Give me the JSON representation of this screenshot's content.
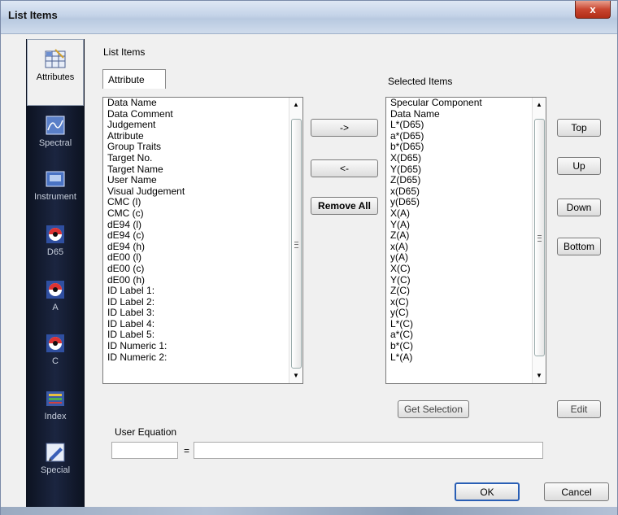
{
  "window": {
    "title": "List Items",
    "close_label": "x"
  },
  "nav": {
    "items": [
      {
        "label": "Attributes",
        "icon": "attributes-grid-icon",
        "active": true
      },
      {
        "label": "Spectral",
        "icon": "spectral-chart-icon"
      },
      {
        "label": "Instrument",
        "icon": "instrument-icon"
      },
      {
        "label": "D65",
        "icon": "illuminant-d65-icon"
      },
      {
        "label": "A",
        "icon": "illuminant-a-icon"
      },
      {
        "label": "C",
        "icon": "illuminant-c-icon"
      },
      {
        "label": "Index",
        "icon": "index-icon"
      },
      {
        "label": "Special",
        "icon": "special-pencil-icon"
      }
    ]
  },
  "main": {
    "section_title": "List Items",
    "tab_label": "Attribute",
    "selected_title": "Selected Items",
    "available_items": [
      "Data Name",
      "Data Comment",
      "Judgement",
      "Attribute",
      "Group Traits",
      "Target No.",
      "Target Name",
      "User Name",
      "Visual Judgement",
      "CMC (l)",
      "CMC (c)",
      "dE94 (l)",
      "dE94 (c)",
      "dE94 (h)",
      "dE00 (l)",
      "dE00 (c)",
      "dE00 (h)",
      "ID Label 1:",
      "ID Label 2:",
      "ID Label 3:",
      "ID Label 4:",
      "ID Label 5:",
      "ID Numeric 1:",
      "ID Numeric 2:"
    ],
    "selected_items": [
      "Specular Component",
      "Data Name",
      "L*(D65)",
      "a*(D65)",
      "b*(D65)",
      "X(D65)",
      "Y(D65)",
      "Z(D65)",
      "x(D65)",
      "y(D65)",
      "X(A)",
      "Y(A)",
      "Z(A)",
      "x(A)",
      "y(A)",
      "X(C)",
      "Y(C)",
      "Z(C)",
      "x(C)",
      "y(C)",
      "L*(C)",
      "a*(C)",
      "b*(C)",
      "L*(A)"
    ],
    "add_button": "->",
    "remove_button": "<-",
    "remove_all_button": "Remove All",
    "top_button": "Top",
    "up_button": "Up",
    "down_button": "Down",
    "bottom_button": "Bottom",
    "get_selection_button": "Get Selection",
    "edit_button": "Edit",
    "user_equation_label": "User Equation",
    "equation_name_value": "",
    "equation_sign": "=",
    "equation_value": ""
  },
  "footer": {
    "ok_label": "OK",
    "cancel_label": "Cancel"
  },
  "colors": {
    "nav_bg": "#141c30",
    "title_bg": "#c4d3e8",
    "close_red": "#c94630",
    "default_border": "#2a5fb5"
  }
}
